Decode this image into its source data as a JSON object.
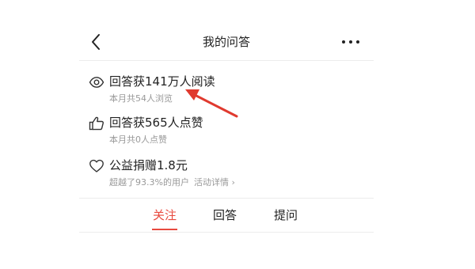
{
  "header": {
    "title": "我的问答"
  },
  "stats": [
    {
      "icon": "eye-icon",
      "title": "回答获141万人阅读",
      "sub": "本月共54人浏览"
    },
    {
      "icon": "thumbs-up-icon",
      "title": "回答获565人点赞",
      "sub": "本月共0人点赞"
    },
    {
      "icon": "heart-icon",
      "title": "公益捐赠1.8元",
      "sub": "超越了93.3%的用户",
      "link": "活动详情 ›"
    }
  ],
  "tabs": [
    {
      "label": "关注",
      "active": true
    },
    {
      "label": "回答",
      "active": false
    },
    {
      "label": "提问",
      "active": false
    }
  ],
  "colors": {
    "accent": "#e8493e",
    "text": "#222222",
    "subtext": "#999999",
    "divider": "#ececec"
  }
}
